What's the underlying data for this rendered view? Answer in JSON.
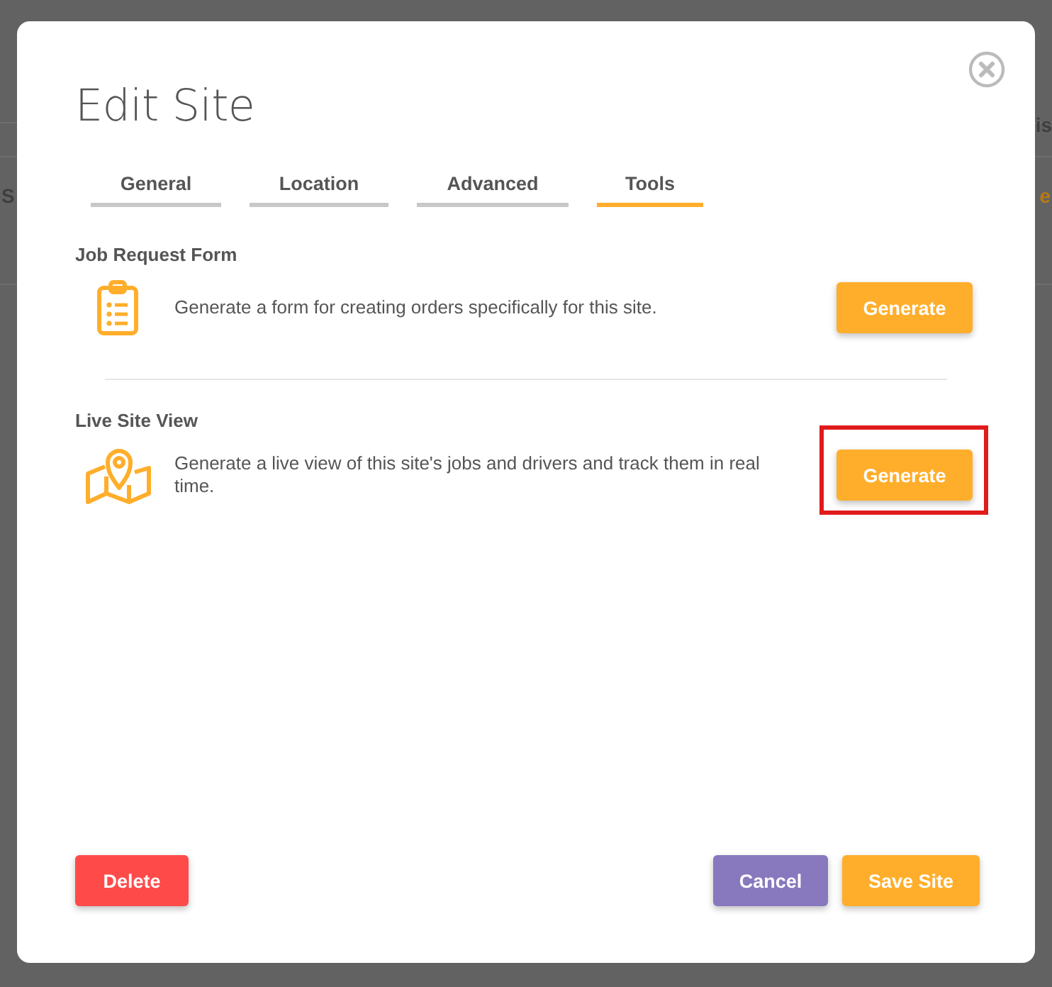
{
  "background": {
    "fragments": [
      {
        "text": "S"
      },
      {
        "text": "is"
      },
      {
        "text": "e"
      }
    ]
  },
  "dialog": {
    "title": "Edit Site"
  },
  "tabs": [
    {
      "label": "General",
      "selected": false
    },
    {
      "label": "Location",
      "selected": false
    },
    {
      "label": "Advanced",
      "selected": false
    },
    {
      "label": "Tools",
      "selected": true
    }
  ],
  "tools": [
    {
      "title": "Job Request Form",
      "kind": "form",
      "description": "Generate a form for creating orders specifically for this site.",
      "button": "Generate",
      "highlighted": false
    },
    {
      "title": "Live Site View",
      "kind": "map",
      "description": "Generate a live view of this site's jobs and drivers and track them in real time.",
      "button": "Generate",
      "highlighted": true
    }
  ],
  "footer": {
    "delete": "Delete",
    "cancel": "Cancel",
    "save": "Save Site"
  }
}
